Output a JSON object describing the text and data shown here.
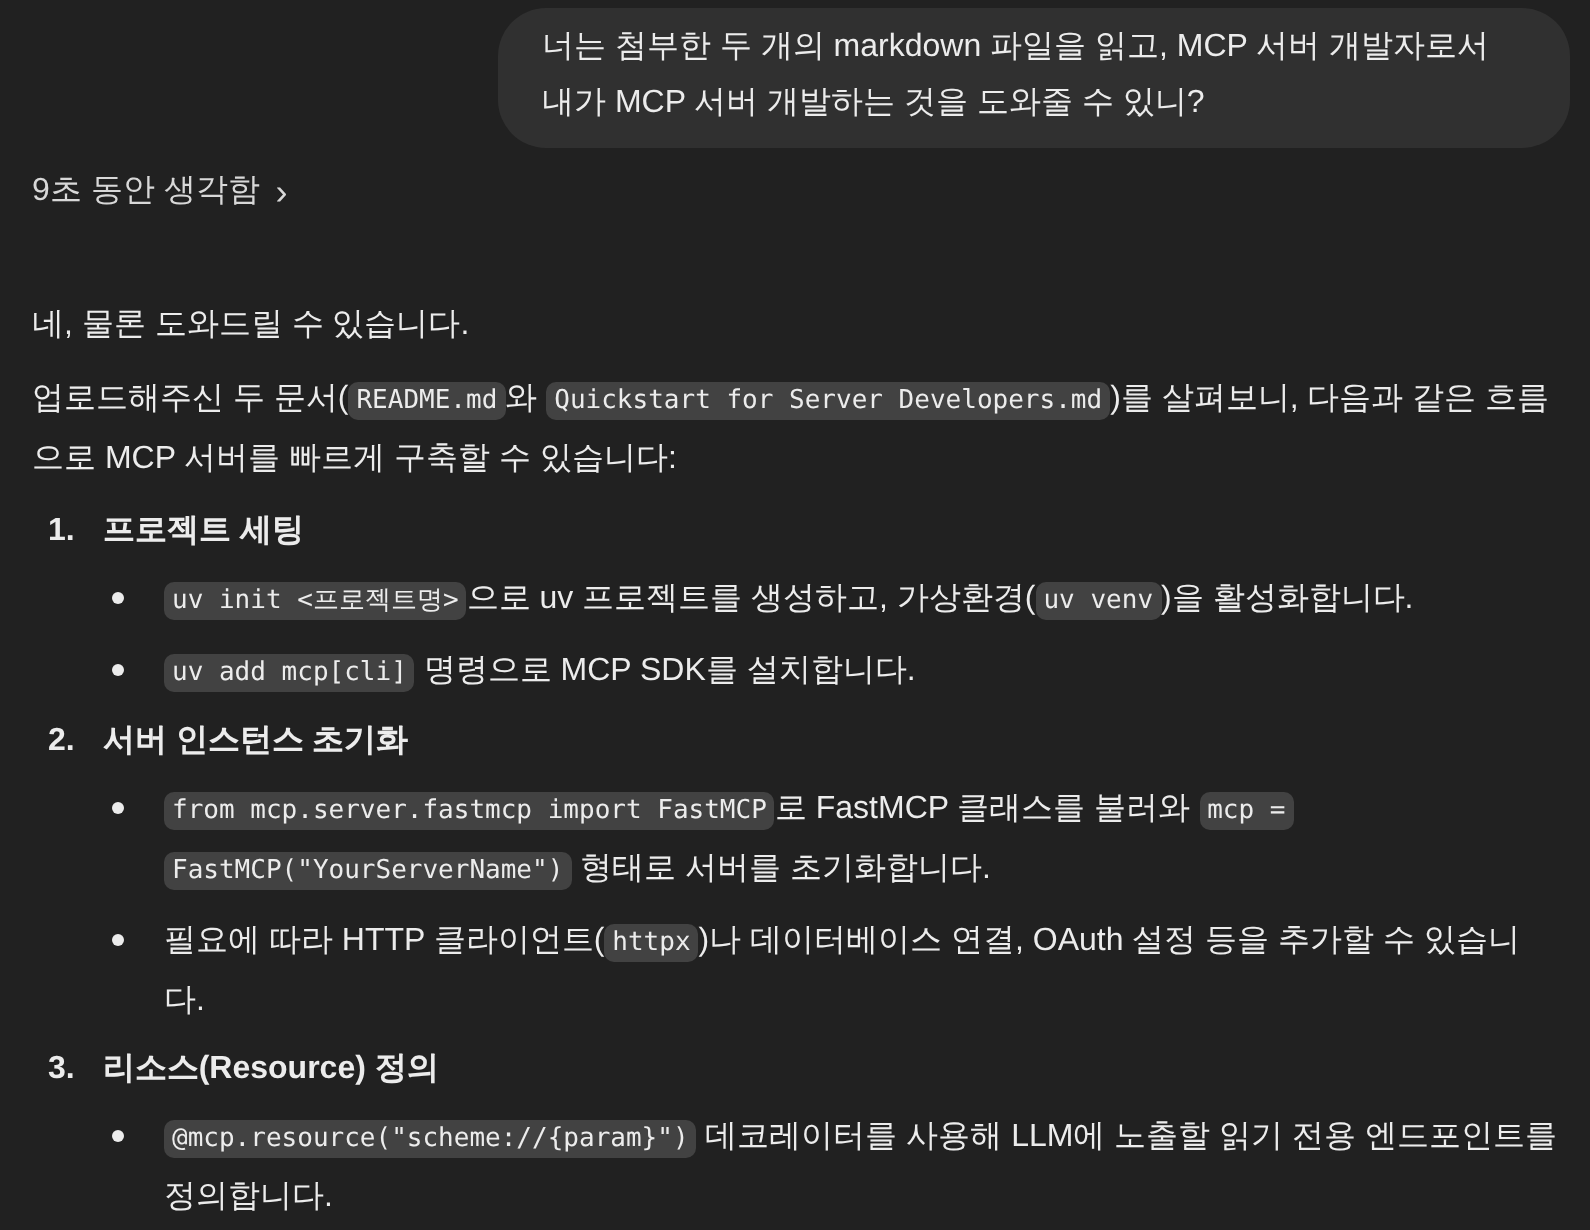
{
  "user_message": {
    "lines": [
      "너는 첨부한 두 개의 markdown 파일을 읽고, MCP 서버 개발자로서",
      "내가 MCP 서버 개발하는 것을 도와줄 수 있니?"
    ]
  },
  "thinking": {
    "label": "9초 동안 생각함",
    "chevron": "›"
  },
  "answer": {
    "paragraphs": [
      [
        [
          {
            "kind": "text",
            "text": "네, 물론 도와드릴 수 있습니다."
          }
        ]
      ],
      [
        [
          {
            "kind": "text",
            "text": "업로드해주신 두 문서("
          },
          {
            "kind": "code",
            "text": "README.md"
          },
          {
            "kind": "text",
            "text": "와 "
          },
          {
            "kind": "code",
            "text": "Quickstart for Server Developers.md"
          },
          {
            "kind": "text",
            "text": ")를 살펴보니, 다음과 같은 흐름"
          }
        ],
        [
          {
            "kind": "text",
            "text": "으로 MCP 서버를 빠르게 구축할 수 있습니다:"
          }
        ]
      ]
    ],
    "steps": [
      {
        "number": "1.",
        "title": "프로젝트 세팅",
        "bullets": [
          [
            [
              {
                "kind": "code",
                "text": "uv init <프로젝트명>"
              },
              {
                "kind": "text",
                "text": "으로 uv 프로젝트를 생성하고, 가상환경("
              },
              {
                "kind": "code",
                "text": "uv venv"
              },
              {
                "kind": "text",
                "text": ")을 활성화합니다."
              }
            ]
          ],
          [
            [
              {
                "kind": "code",
                "text": "uv add mcp[cli]"
              },
              {
                "kind": "text",
                "text": " 명령으로 MCP SDK를 설치합니다."
              }
            ]
          ]
        ]
      },
      {
        "number": "2.",
        "title": "서버 인스턴스 초기화",
        "bullets": [
          [
            [
              {
                "kind": "code",
                "text": "from mcp.server.fastmcp import FastMCP"
              },
              {
                "kind": "text",
                "text": "로 FastMCP 클래스를 불러와 "
              },
              {
                "kind": "code",
                "text": "mcp ="
              }
            ],
            [
              {
                "kind": "code",
                "text": "FastMCP(\"YourServerName\")"
              },
              {
                "kind": "text",
                "text": " 형태로 서버를 초기화합니다."
              }
            ]
          ],
          [
            [
              {
                "kind": "text",
                "text": "필요에 따라 HTTP 클라이언트("
              },
              {
                "kind": "code",
                "text": "httpx"
              },
              {
                "kind": "text",
                "text": ")나 데이터베이스 연결, OAuth 설정 등을 추가할 수 있습니"
              }
            ],
            [
              {
                "kind": "text",
                "text": "다."
              }
            ]
          ]
        ]
      },
      {
        "number": "3.",
        "title": "리소스(Resource) 정의",
        "bullets": [
          [
            [
              {
                "kind": "code",
                "text": "@mcp.resource(\"scheme://{param}\")"
              },
              {
                "kind": "text",
                "text": " 데코레이터를 사용해 LLM에 노출할 읽기 전용 엔드포인트를"
              }
            ],
            [
              {
                "kind": "text",
                "text": "정의합니다."
              }
            ]
          ]
        ]
      }
    ]
  }
}
